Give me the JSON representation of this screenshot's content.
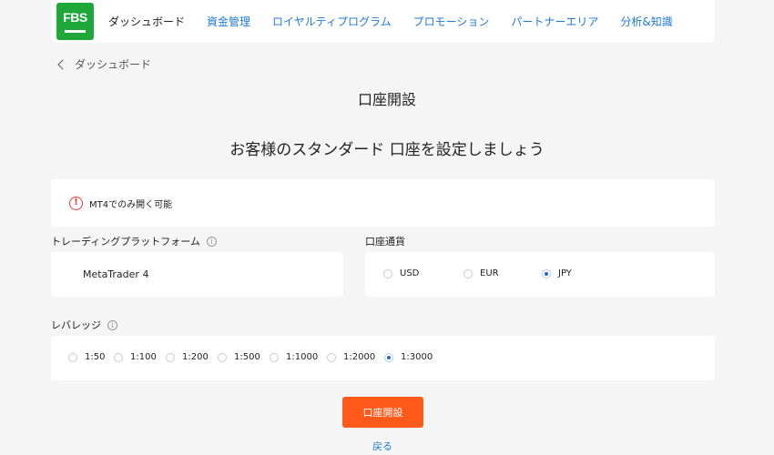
{
  "brand": {
    "logo_text": "FBS",
    "color": "#1ea83a"
  },
  "nav": {
    "items": [
      {
        "label": "ダッシュボード",
        "active": true
      },
      {
        "label": "資金管理"
      },
      {
        "label": "ロイヤルティプログラム"
      },
      {
        "label": "プロモーション"
      },
      {
        "label": "パートナーエリア"
      },
      {
        "label": "分析&知識"
      }
    ]
  },
  "breadcrumb": {
    "back_label": "ダッシュボード"
  },
  "page": {
    "title": "口座開設",
    "subtitle": "お客様のスタンダード 口座を設定しましょう"
  },
  "notice": {
    "icon": "warning-icon",
    "text": "MT4でのみ開く可能"
  },
  "platform": {
    "label": "トレーディングプラットフォーム",
    "value": "MetaTrader 4"
  },
  "currency": {
    "label": "口座通貨",
    "options": [
      "USD",
      "EUR",
      "JPY"
    ],
    "selected": "JPY"
  },
  "leverage": {
    "label": "レバレッジ",
    "options": [
      "1:50",
      "1:100",
      "1:200",
      "1:500",
      "1:1000",
      "1:2000",
      "1:3000"
    ],
    "selected": "1:3000"
  },
  "actions": {
    "submit_label": "口座開設",
    "back_label": "戻る",
    "accent": "#ff5a1a",
    "link_color": "#1f7ad6"
  }
}
